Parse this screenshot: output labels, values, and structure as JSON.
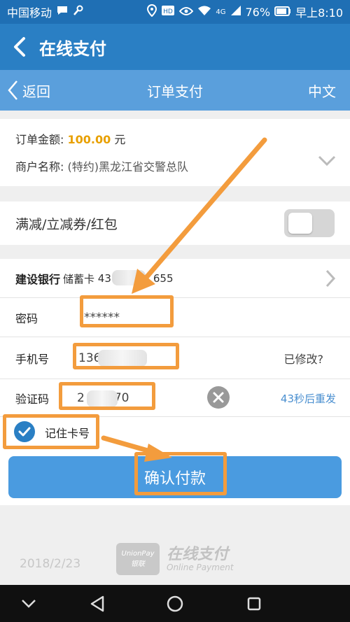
{
  "status_bar": {
    "carrier": "中国移动",
    "network": "4G",
    "battery": "76%",
    "time": "早上8:10"
  },
  "app_bar": {
    "title": "在线支付"
  },
  "sub_bar": {
    "back_label": "返回",
    "title": "订单支付",
    "lang_label": "中文"
  },
  "order": {
    "amount_label": "订单金额:",
    "amount_value": "100.00",
    "amount_unit": "元",
    "merchant_label": "商户名称:",
    "merchant_value": "(特约)黑龙江省交警总队"
  },
  "promo": {
    "label": "满减/立减券/红包",
    "enabled": false
  },
  "payment": {
    "bank_label": "建设银行",
    "card_type": "储蓄卡",
    "card_prefix": "43",
    "card_suffix": "655",
    "password_label": "密码",
    "password_value": "******",
    "phone_label": "手机号",
    "phone_prefix": "136",
    "phone_modified": "已修改?",
    "code_label": "验证码",
    "code_prefix": "2",
    "code_suffix": "70",
    "resend_label": "43秒后重发"
  },
  "remember": {
    "label": "记住卡号",
    "checked": true
  },
  "confirm_label": "确认付款",
  "footer": {
    "date": "2018/2/23",
    "logo_top": "UnionPay",
    "logo_bottom": "银联",
    "brand": "在线支付",
    "brand_en": "Online Payment"
  },
  "colors": {
    "accent": "#2a7fc4",
    "annotation": "#f39c3d",
    "amount": "#e8a000"
  }
}
